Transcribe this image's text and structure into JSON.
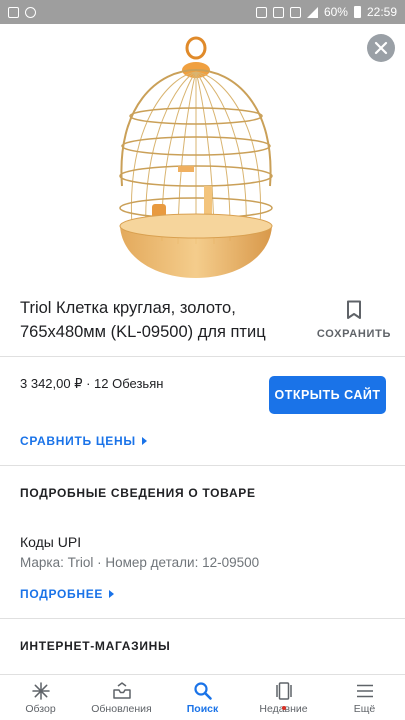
{
  "status_bar": {
    "battery": "60%",
    "time": "22:59"
  },
  "product": {
    "title": "Triol Клетка круглая, золото, 765x480мм (KL-09500) для птиц",
    "save_label": "СОХРАНИТЬ",
    "price_line": "3 342,00 ₽ · 12 Обезьян",
    "open_site_label": "ОТКРЫТЬ САЙТ",
    "compare_prices_label": "СРАВНИТЬ ЦЕНЫ"
  },
  "details": {
    "heading": "ПОДРОБНЫЕ СВЕДЕНИЯ О ТОВАРЕ",
    "upi_title": "Коды UPI",
    "upi_detail": "Марка: Triol · Номер детали: 12-09500",
    "more_label": "ПОДРОБНЕЕ"
  },
  "stores": {
    "heading": "ИНТЕРНЕТ-МАГАЗИНЫ"
  },
  "bottom_nav": [
    {
      "label": "Обзор",
      "icon": "asterisk-icon"
    },
    {
      "label": "Обновления",
      "icon": "inbox-icon"
    },
    {
      "label": "Поиск",
      "icon": "search-icon"
    },
    {
      "label": "Недавние",
      "icon": "recent-cards-icon"
    },
    {
      "label": "Ещё",
      "icon": "menu-icon"
    }
  ],
  "colors": {
    "accent": "#1a73e8",
    "text": "#202124",
    "secondary": "#70757a"
  }
}
